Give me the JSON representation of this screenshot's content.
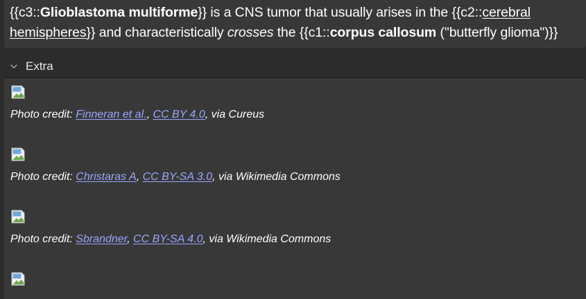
{
  "field": {
    "line1": {
      "c3_open": "{{c3::",
      "c3_term": "Glioblastoma multiforme",
      "c3_close": "}}",
      "middle": " is a CNS tumor that usually arises in the ",
      "c2_open": "{{c2::",
      "c2_term_a": "cerebral"
    },
    "line2": {
      "c2_term_b": "hemispheres",
      "c2_close": "}}",
      "and": " and characteristically ",
      "crosses": "crosses",
      "the": " the ",
      "c1_open": "{{c1::",
      "c1_term": "corpus callosum",
      "c1_rest": " (\"butterfly glioma\")}}"
    }
  },
  "extra": {
    "header_label": "Extra",
    "credits": [
      {
        "prefix": "Photo credit: ",
        "author": "Finneran et al.",
        "sep": ", ",
        "license": "CC BY 4.0",
        "suffix": ", via Cureus"
      },
      {
        "prefix": "Photo credit: ",
        "author": "Christaras A",
        "sep": ", ",
        "license": "CC BY-SA 3.0",
        "suffix": ", via Wikimedia Commons"
      },
      {
        "prefix": "Photo credit: ",
        "author": "Sbrandner",
        "sep": ", ",
        "license": "CC BY-SA 4.0",
        "suffix": ", via Wikimedia Commons"
      }
    ]
  },
  "colors": {
    "background": "#2c2c2c",
    "panel": "#383838",
    "link": "#9aa7ff",
    "text": "#ffffff"
  },
  "icons": {
    "chevron": "chevron-down-icon",
    "broken_image": "broken-image-icon"
  }
}
